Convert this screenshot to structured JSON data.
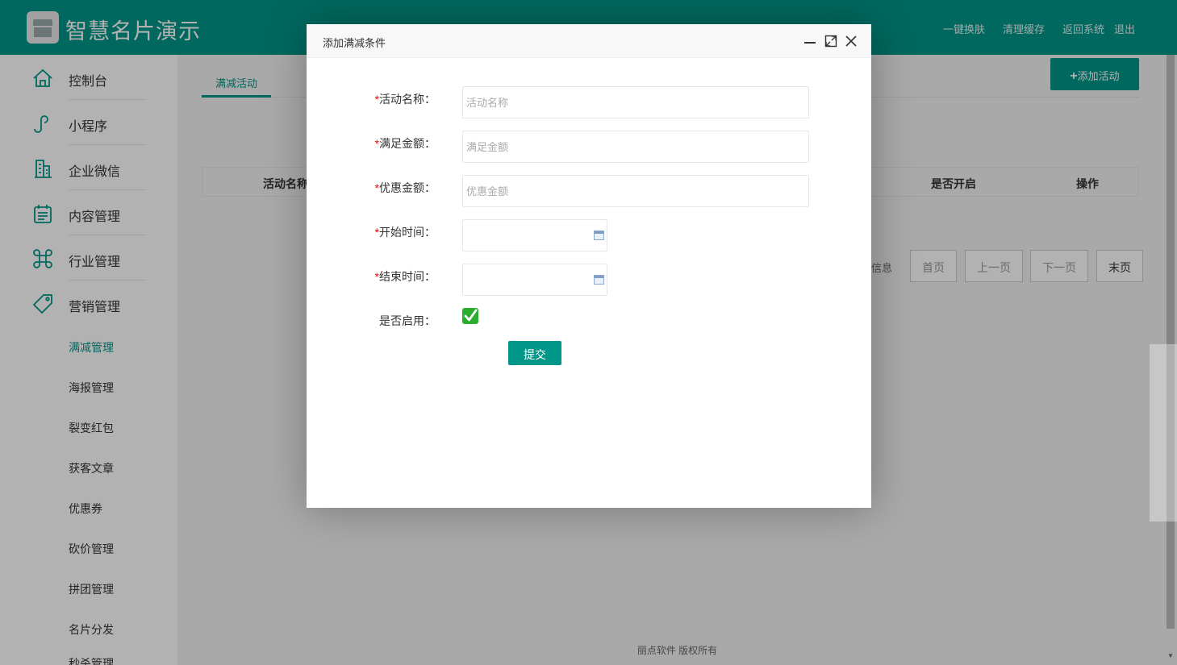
{
  "header": {
    "app_title": "智慧名片演示",
    "links": [
      "一键换肤",
      "清理缓存",
      "返回系统",
      "退出"
    ]
  },
  "sidebar": {
    "items": [
      {
        "label": "控制台",
        "icon": "home-icon"
      },
      {
        "label": "小程序",
        "icon": "mini-program-icon"
      },
      {
        "label": "企业微信",
        "icon": "building-icon"
      },
      {
        "label": "内容管理",
        "icon": "calendar-list-icon"
      },
      {
        "label": "行业管理",
        "icon": "command-icon"
      },
      {
        "label": "营销管理",
        "icon": "tag-icon"
      }
    ],
    "sub_items": [
      "满减管理",
      "海报管理",
      "裂变红包",
      "获客文章",
      "优惠券",
      "砍价管理",
      "拼团管理",
      "名片分发",
      "秒杀管理"
    ],
    "active_sub_item": "满减管理"
  },
  "main": {
    "tab": "满减活动",
    "add_button": "添加活动",
    "table_columns": [
      "活动名称",
      "是否开启",
      "操作"
    ],
    "pager": {
      "info": "信息",
      "buttons": [
        "首页",
        "上一页",
        "下一页",
        "末页"
      ]
    },
    "footer": "丽点软件 版权所有"
  },
  "dialog": {
    "title": "添加满减条件",
    "fields": [
      {
        "required": "*",
        "label": "活动名称：",
        "placeholder": "活动名称",
        "value": ""
      },
      {
        "required": "*",
        "label": "满足金额：",
        "placeholder": "满足金额",
        "value": ""
      },
      {
        "required": "*",
        "label": "优惠金额：",
        "placeholder": "优惠金额",
        "value": ""
      },
      {
        "required": "*",
        "label": "开始时间：",
        "value": ""
      },
      {
        "required": "*",
        "label": "结束时间：",
        "value": ""
      }
    ],
    "enabled_label": "是否启用：",
    "enabled_checked": true,
    "submit_label": "提交"
  },
  "colors": {
    "primary": "#009688",
    "required": "#ff0000",
    "checkbox": "#2bad2f"
  }
}
